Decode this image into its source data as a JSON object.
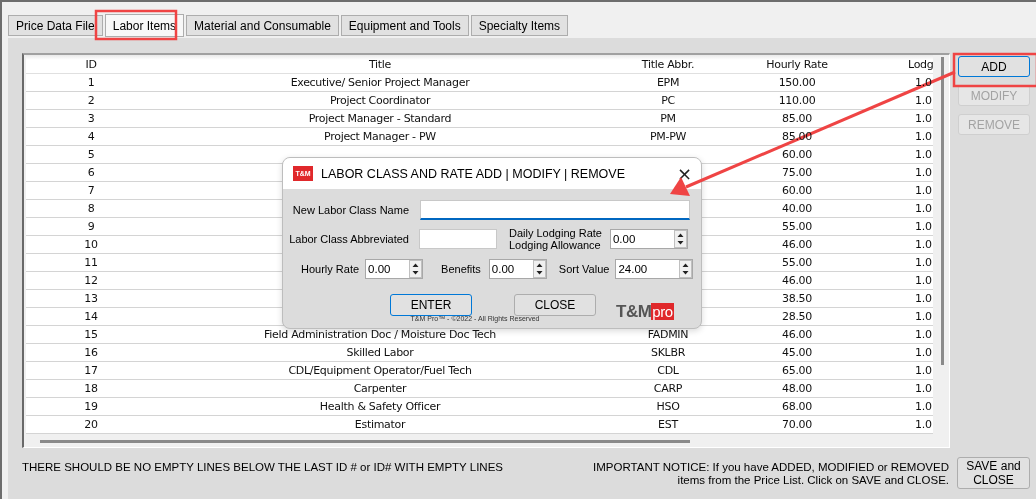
{
  "tabs": [
    {
      "label": "Price Data File",
      "selected": false
    },
    {
      "label": "Labor Items",
      "selected": true
    },
    {
      "label": "Material and Consumable",
      "selected": false
    },
    {
      "label": "Equipment and Tools",
      "selected": false
    },
    {
      "label": "Specialty Items",
      "selected": false
    }
  ],
  "table": {
    "columns": [
      "ID",
      "Title",
      "Title Abbr.",
      "Hourly Rate",
      "Lodg"
    ],
    "rows": [
      {
        "id": "1",
        "title": "Executive/ Senior Project Manager",
        "abbr": "EPM",
        "hourly_rate": "150.00",
        "lodging": "1.0"
      },
      {
        "id": "2",
        "title": "Project Coordinator",
        "abbr": "PC",
        "hourly_rate": "110.00",
        "lodging": "1.0"
      },
      {
        "id": "3",
        "title": "Project Manager - Standard",
        "abbr": "PM",
        "hourly_rate": "85.00",
        "lodging": "1.0"
      },
      {
        "id": "4",
        "title": "Project Manager - PW",
        "abbr": "PM-PW",
        "hourly_rate": "85.00",
        "lodging": "1.0"
      },
      {
        "id": "5",
        "hourly_rate": "60.00",
        "lodging": "1.0"
      },
      {
        "id": "6",
        "hourly_rate": "75.00",
        "lodging": "1.0"
      },
      {
        "id": "7",
        "hourly_rate": "60.00",
        "lodging": "1.0"
      },
      {
        "id": "8",
        "hourly_rate": "40.00",
        "lodging": "1.0"
      },
      {
        "id": "9",
        "hourly_rate": "55.00",
        "lodging": "1.0"
      },
      {
        "id": "10",
        "hourly_rate": "46.00",
        "lodging": "1.0"
      },
      {
        "id": "11",
        "hourly_rate": "55.00",
        "lodging": "1.0"
      },
      {
        "id": "12",
        "hourly_rate": "46.00",
        "lodging": "1.0"
      },
      {
        "id": "13",
        "hourly_rate": "38.50",
        "lodging": "1.0"
      },
      {
        "id": "14",
        "hourly_rate": "28.50",
        "lodging": "1.0"
      },
      {
        "id": "15",
        "title": "Field Administration Doc / Moisture Doc Tech",
        "abbr": "FADMIN",
        "hourly_rate": "46.00",
        "lodging": "1.0"
      },
      {
        "id": "16",
        "title": "Skilled Labor",
        "abbr": "SKLBR",
        "hourly_rate": "45.00",
        "lodging": "1.0"
      },
      {
        "id": "17",
        "title": "CDL/Equipment Operator/Fuel Tech",
        "abbr": "CDL",
        "hourly_rate": "65.00",
        "lodging": "1.0"
      },
      {
        "id": "18",
        "title": "Carpenter",
        "abbr": "CARP",
        "hourly_rate": "48.00",
        "lodging": "1.0"
      },
      {
        "id": "19",
        "title": "Health & Safety Officer",
        "abbr": "HSO",
        "hourly_rate": "68.00",
        "lodging": "1.0"
      },
      {
        "id": "20",
        "title": "Estimator",
        "abbr": "EST",
        "hourly_rate": "70.00",
        "lodging": "1.0"
      }
    ]
  },
  "side_buttons": [
    {
      "label": "ADD",
      "disabled": false
    },
    {
      "label": "MODIFY",
      "disabled": true
    },
    {
      "label": "REMOVE",
      "disabled": true
    }
  ],
  "empty_lines_note": "THERE SHOULD BE NO EMPTY LINES BELOW THE LAST ID # or ID# WITH EMPTY LINES",
  "important_notice": "IMPORTANT NOTICE:  If you have ADDED, MODIFIED or REMOVED\nitems from the Price List.  Click on SAVE and CLOSE.",
  "save_button": "SAVE and\nCLOSE",
  "dialog": {
    "badge": "T&M",
    "title": "LABOR CLASS AND RATE ADD | MODIFY | REMOVE",
    "close": "×",
    "name_field": {
      "label": "New Labor Class Name"
    },
    "abbr_field": {
      "label": "Labor Class Abbreviated"
    },
    "lodging_field": {
      "label": "Daily Lodging Rate\nLodging Allowance",
      "value": "0.00"
    },
    "hourly_field": {
      "label": "Hourly Rate",
      "value": "0.00"
    },
    "benefits_field": {
      "label": "Benefits",
      "value": "0.00"
    },
    "sort_field": {
      "label": "Sort Value",
      "value": "24.00"
    },
    "buttons": [
      {
        "label": "ENTER",
        "focused": true
      },
      {
        "label": "CLOSE",
        "focused": false
      }
    ],
    "logo": {
      "main": "T&M",
      "accent": "pro"
    },
    "copyright": "T&M Pro™ - ©2022 - All Rights Reserved"
  }
}
